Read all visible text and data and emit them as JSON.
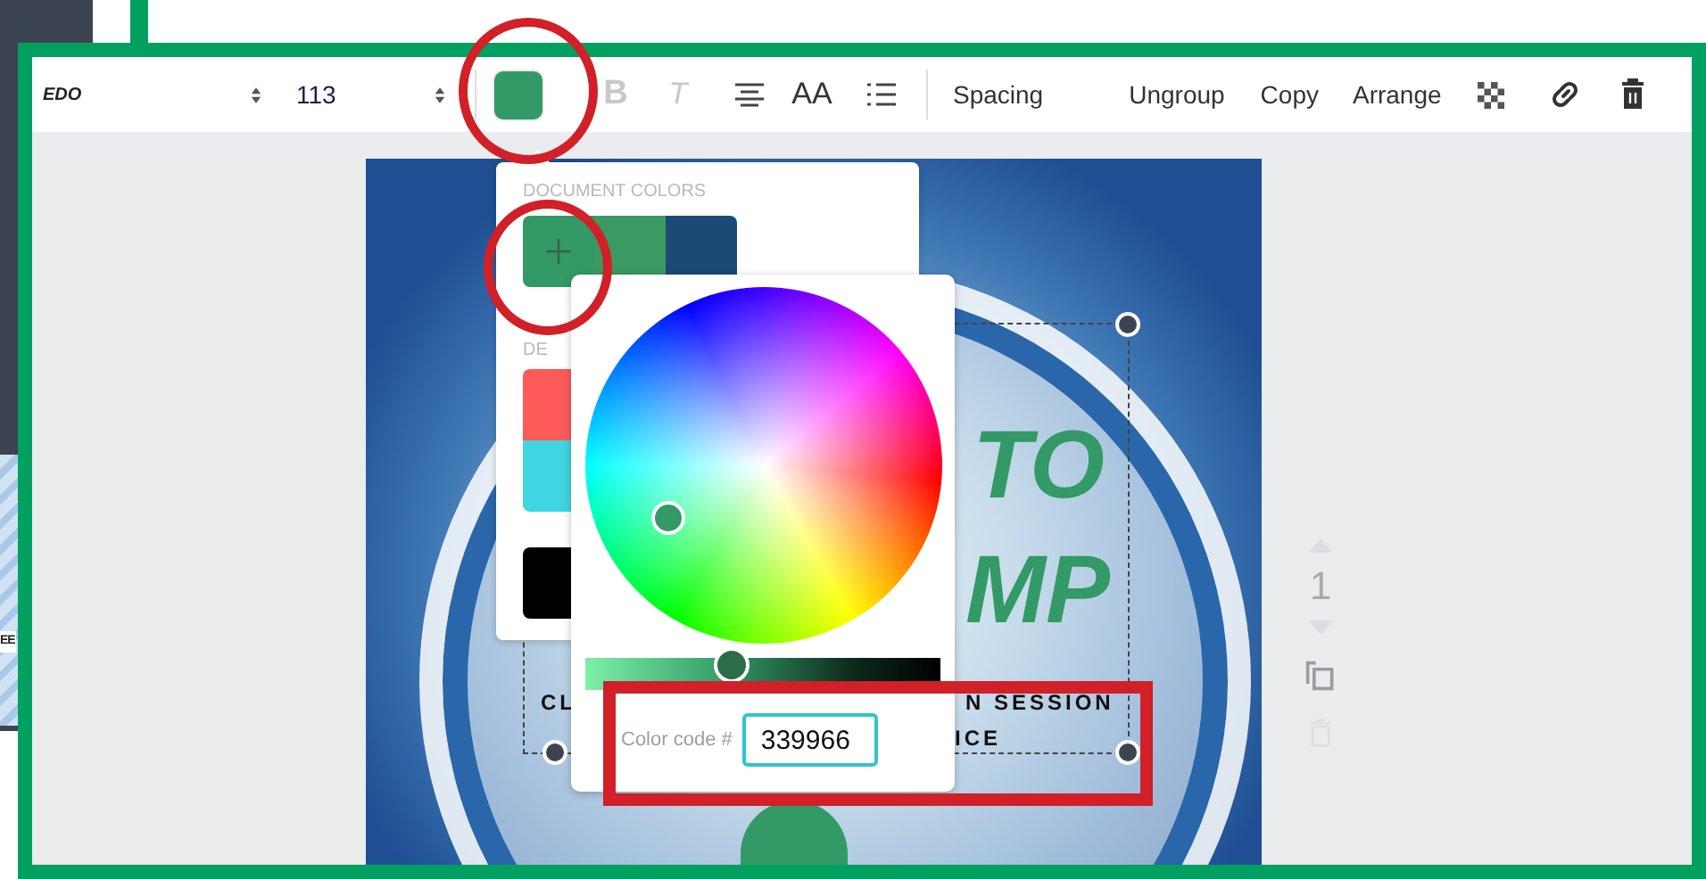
{
  "sidebar": {
    "thumbnail_text": "EE"
  },
  "toolbar": {
    "font": "EDO",
    "font_size": "113",
    "text_color": {
      "color": "#339966",
      "selected": true
    },
    "bold": {
      "label": "B",
      "disabled": true
    },
    "italic": {
      "label": "T",
      "disabled": true
    },
    "letter_case": {
      "label": "AA",
      "disabled": false
    },
    "buttons": [
      "Spacing",
      "Ungroup",
      "Copy",
      "Arrange"
    ]
  },
  "colors_popup": {
    "document_title": "DOCUMENT COLORS",
    "document_colors": [
      {
        "kind": "add",
        "color": "#339966"
      },
      {
        "kind": "swatch",
        "color": "#3a9a62"
      },
      {
        "kind": "swatch",
        "color": "#1b4a76"
      }
    ],
    "default_title": "DE",
    "default_colors": [
      {
        "color": "#fe5a5a"
      },
      {
        "color": "#3fd6e1"
      },
      {
        "color": "#000000"
      }
    ]
  },
  "color_picker": {
    "shade_slider": {
      "level": 0.4
    },
    "code_label": "Color code #",
    "code_value": "339966"
  },
  "design": {
    "headline": [
      "TO",
      "MP"
    ],
    "subtitle": [
      "CL",
      "N SESSION",
      "ICE"
    ]
  },
  "page_controls": {
    "page_number": "1"
  }
}
